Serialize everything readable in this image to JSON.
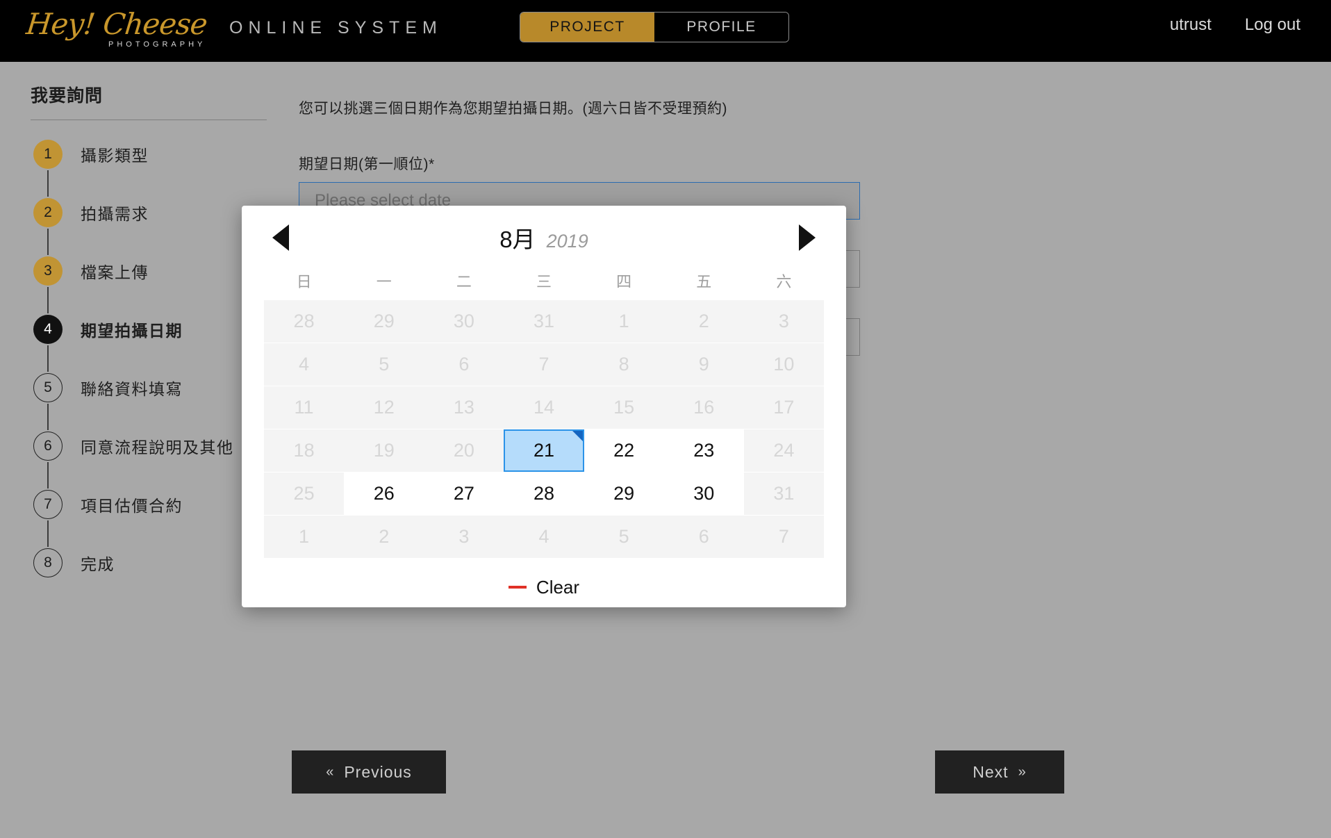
{
  "header": {
    "logo_script": "Hey! Cheese",
    "logo_sub": "PHOTOGRAPHY",
    "system_name": "ONLINE SYSTEM",
    "toggle": [
      {
        "label": "PROJECT",
        "active": true
      },
      {
        "label": "PROFILE",
        "active": false
      }
    ],
    "user": "utrust",
    "logout": "Log out",
    "accent_color": "#b8892a",
    "background_color": "#000000"
  },
  "sidebar": {
    "title": "我要詢問",
    "steps": [
      {
        "num": "1",
        "label": "攝影類型",
        "state": "done"
      },
      {
        "num": "2",
        "label": "拍攝需求",
        "state": "done"
      },
      {
        "num": "3",
        "label": "檔案上傳",
        "state": "done"
      },
      {
        "num": "4",
        "label": "期望拍攝日期",
        "state": "current"
      },
      {
        "num": "5",
        "label": "聯絡資料填寫",
        "state": "todo"
      },
      {
        "num": "6",
        "label": "同意流程說明及其他",
        "state": "todo"
      },
      {
        "num": "7",
        "label": "項目估價合約",
        "state": "todo"
      },
      {
        "num": "8",
        "label": "完成",
        "state": "todo"
      }
    ]
  },
  "main": {
    "intro": "您可以挑選三個日期作為您期望拍攝日期。(週六日皆不受理預約)",
    "field_label": "期望日期(第一順位)*",
    "date_placeholder": "Please select date",
    "date_value": ""
  },
  "datepicker": {
    "month": "8月",
    "year": "2019",
    "prev_icon": "triangle-left-icon",
    "next_icon": "triangle-right-icon",
    "weekdays": [
      "日",
      "一",
      "二",
      "三",
      "四",
      "五",
      "六"
    ],
    "clear_label": "Clear",
    "clear_icon": "minus-icon",
    "clear_icon_color": "#e03127",
    "selected_day": "21",
    "selected_border_color": "#2b93e8",
    "selected_fill_color": "#b5dcfb",
    "weeks": [
      [
        {
          "d": "28",
          "state": "disabled"
        },
        {
          "d": "29",
          "state": "disabled"
        },
        {
          "d": "30",
          "state": "disabled"
        },
        {
          "d": "31",
          "state": "disabled"
        },
        {
          "d": "1",
          "state": "disabled"
        },
        {
          "d": "2",
          "state": "disabled"
        },
        {
          "d": "3",
          "state": "disabled"
        }
      ],
      [
        {
          "d": "4",
          "state": "disabled"
        },
        {
          "d": "5",
          "state": "disabled"
        },
        {
          "d": "6",
          "state": "disabled"
        },
        {
          "d": "7",
          "state": "disabled"
        },
        {
          "d": "8",
          "state": "disabled"
        },
        {
          "d": "9",
          "state": "disabled"
        },
        {
          "d": "10",
          "state": "disabled"
        }
      ],
      [
        {
          "d": "11",
          "state": "disabled"
        },
        {
          "d": "12",
          "state": "disabled"
        },
        {
          "d": "13",
          "state": "disabled"
        },
        {
          "d": "14",
          "state": "disabled"
        },
        {
          "d": "15",
          "state": "disabled"
        },
        {
          "d": "16",
          "state": "disabled"
        },
        {
          "d": "17",
          "state": "disabled"
        }
      ],
      [
        {
          "d": "18",
          "state": "disabled"
        },
        {
          "d": "19",
          "state": "disabled"
        },
        {
          "d": "20",
          "state": "disabled"
        },
        {
          "d": "21",
          "state": "selected"
        },
        {
          "d": "22",
          "state": "enabled"
        },
        {
          "d": "23",
          "state": "enabled"
        },
        {
          "d": "24",
          "state": "disabled"
        }
      ],
      [
        {
          "d": "25",
          "state": "disabled"
        },
        {
          "d": "26",
          "state": "enabled"
        },
        {
          "d": "27",
          "state": "enabled"
        },
        {
          "d": "28",
          "state": "enabled"
        },
        {
          "d": "29",
          "state": "enabled"
        },
        {
          "d": "30",
          "state": "enabled"
        },
        {
          "d": "31",
          "state": "disabled"
        }
      ],
      [
        {
          "d": "1",
          "state": "disabled"
        },
        {
          "d": "2",
          "state": "disabled"
        },
        {
          "d": "3",
          "state": "disabled"
        },
        {
          "d": "4",
          "state": "disabled"
        },
        {
          "d": "5",
          "state": "disabled"
        },
        {
          "d": "6",
          "state": "disabled"
        },
        {
          "d": "7",
          "state": "disabled"
        }
      ]
    ]
  },
  "footer": {
    "previous_label": "Previous",
    "previous_chevron": "«",
    "next_label": "Next",
    "next_chevron": "»"
  }
}
